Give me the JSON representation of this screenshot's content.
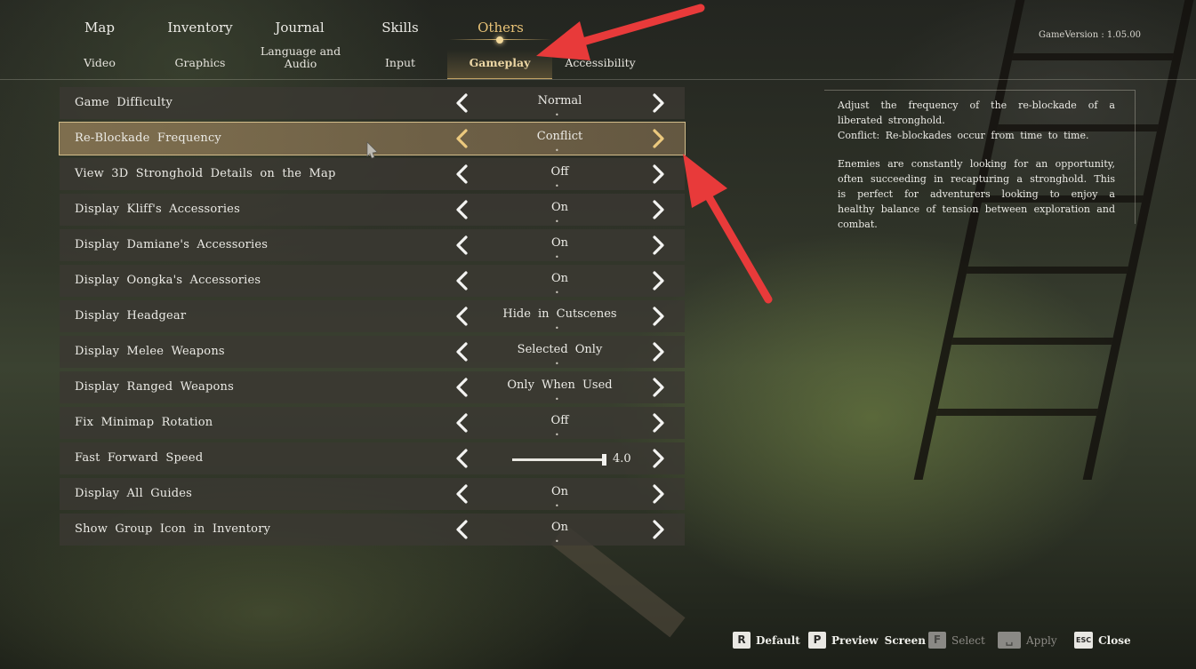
{
  "nav": {
    "tabs": [
      {
        "label": "Map"
      },
      {
        "label": "Inventory"
      },
      {
        "label": "Journal"
      },
      {
        "label": "Skills"
      },
      {
        "label": "Others"
      }
    ],
    "active_tab": "Others",
    "subtabs": [
      {
        "label": "Video"
      },
      {
        "label": "Graphics"
      },
      {
        "label": "Language and Audio"
      },
      {
        "label": "Input"
      },
      {
        "label": "Gameplay"
      },
      {
        "label": "Accessibility"
      }
    ],
    "active_subtab": "Gameplay",
    "version": "GameVersion : 1.05.00"
  },
  "settings": [
    {
      "label": "Game Difficulty",
      "value": "Normal"
    },
    {
      "label": "Re-Blockade Frequency",
      "value": "Conflict",
      "selected": true
    },
    {
      "label": "View 3D Stronghold Details on the Map",
      "value": "Off"
    },
    {
      "label": "Display Kliff's Accessories",
      "value": "On"
    },
    {
      "label": "Display Damiane's Accessories",
      "value": "On"
    },
    {
      "label": "Display Oongka's Accessories",
      "value": "On"
    },
    {
      "label": "Display Headgear",
      "value": "Hide in Cutscenes"
    },
    {
      "label": "Display Melee Weapons",
      "value": "Selected Only"
    },
    {
      "label": "Display Ranged Weapons",
      "value": "Only When Used"
    },
    {
      "label": "Fix Minimap Rotation",
      "value": "Off"
    },
    {
      "label": "Fast Forward Speed",
      "value": "4.0",
      "slider": {
        "min": 1.0,
        "max": 4.0,
        "value": 4.0
      }
    },
    {
      "label": "Display All Guides",
      "value": "On"
    },
    {
      "label": "Show Group Icon in Inventory",
      "value": "On"
    }
  ],
  "description": {
    "line1": "Adjust the frequency of the re-blockade of a liberated stronghold.",
    "line2": "Conflict: Re-blockades occur from time to time.",
    "line3": "Enemies are constantly looking for an opportunity, often succeeding in recapturing a stronghold. This is perfect for adventurers looking to enjoy a healthy balance of tension between exploration and combat."
  },
  "footer": [
    {
      "key": "R",
      "label": "Default",
      "enabled": true
    },
    {
      "key": "P",
      "label": "Preview Screen",
      "enabled": true
    },
    {
      "key": "F",
      "label": "Select",
      "enabled": false
    },
    {
      "key": "␣",
      "label": "Apply",
      "enabled": false
    },
    {
      "key": "ESC",
      "label": "Close",
      "enabled": true
    }
  ],
  "colors": {
    "accent": "#e8c277",
    "annotation": "#e83a3a",
    "row_bg": "#3a3832"
  },
  "icons": {
    "arrow_left": "chevron-left-icon",
    "arrow_right": "chevron-right-icon"
  }
}
